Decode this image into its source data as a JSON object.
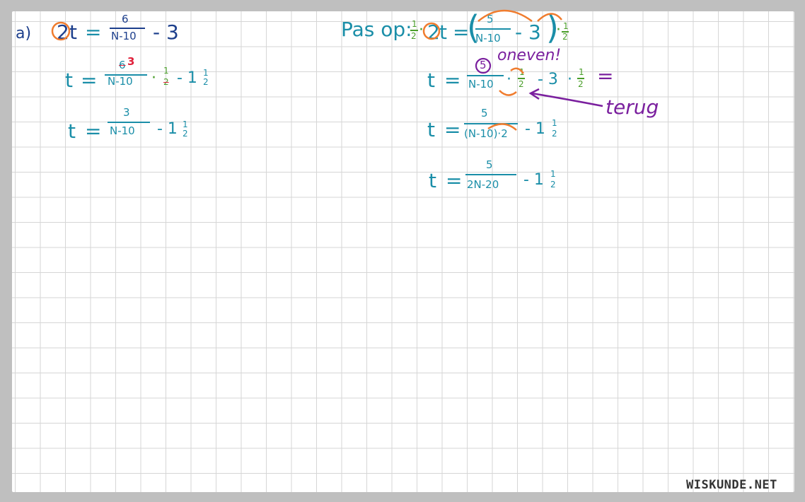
{
  "watermark": "WISKUNDE.NET",
  "left": {
    "part_label": "a)",
    "line1": {
      "coef": "2",
      "var": "t",
      "eq": "=",
      "num": "6",
      "den": "N-10",
      "tail": "- 3"
    },
    "line2": {
      "var": "t",
      "eq": "=",
      "num_crossed": "6",
      "num_new": "3",
      "den": "N-10",
      "dot": "·",
      "half_num": "1",
      "half_den": "2",
      "tail": "- 1",
      "frac_num": "1",
      "frac_den": "2"
    },
    "line3": {
      "var": "t",
      "eq": "=",
      "num": "3",
      "den": "N-10",
      "tail": "- 1",
      "frac_num": "1",
      "frac_den": "2"
    }
  },
  "right": {
    "intro": "Pas op:",
    "line1": {
      "half_num": "1",
      "half_den": "2",
      "dot": "·",
      "coef": "2",
      "var": "t",
      "eq": "=",
      "open": "(",
      "num": "5",
      "den": "N-10",
      "minus": "- 3",
      "close": ")",
      "dot2": "·",
      "half2_num": "1",
      "half2_den": "2"
    },
    "note_odd": "oneven!",
    "line2": {
      "var": "t",
      "eq": "=",
      "num": "5",
      "den": "N-10",
      "dot": "·",
      "half_num": "1",
      "half_den": "2",
      "minus": "- 3",
      "dot2": "·",
      "half2_num": "1",
      "half2_den": "2",
      "eq2": "="
    },
    "note_back": "terug",
    "line3": {
      "var": "t",
      "eq": "=",
      "num": "5",
      "den": "(N-10)·2",
      "tail": "- 1",
      "frac_num": "1",
      "frac_den": "2"
    },
    "line4": {
      "var": "t",
      "eq": "=",
      "num": "5",
      "den": "2N-20",
      "tail": "- 1",
      "frac_num": "1",
      "frac_den": "2"
    }
  },
  "colors": {
    "teal": "#1a8ea8",
    "orange": "#f07c2e",
    "green": "#4a9e2a",
    "red": "#e0203a",
    "purple": "#7a1f9e"
  }
}
